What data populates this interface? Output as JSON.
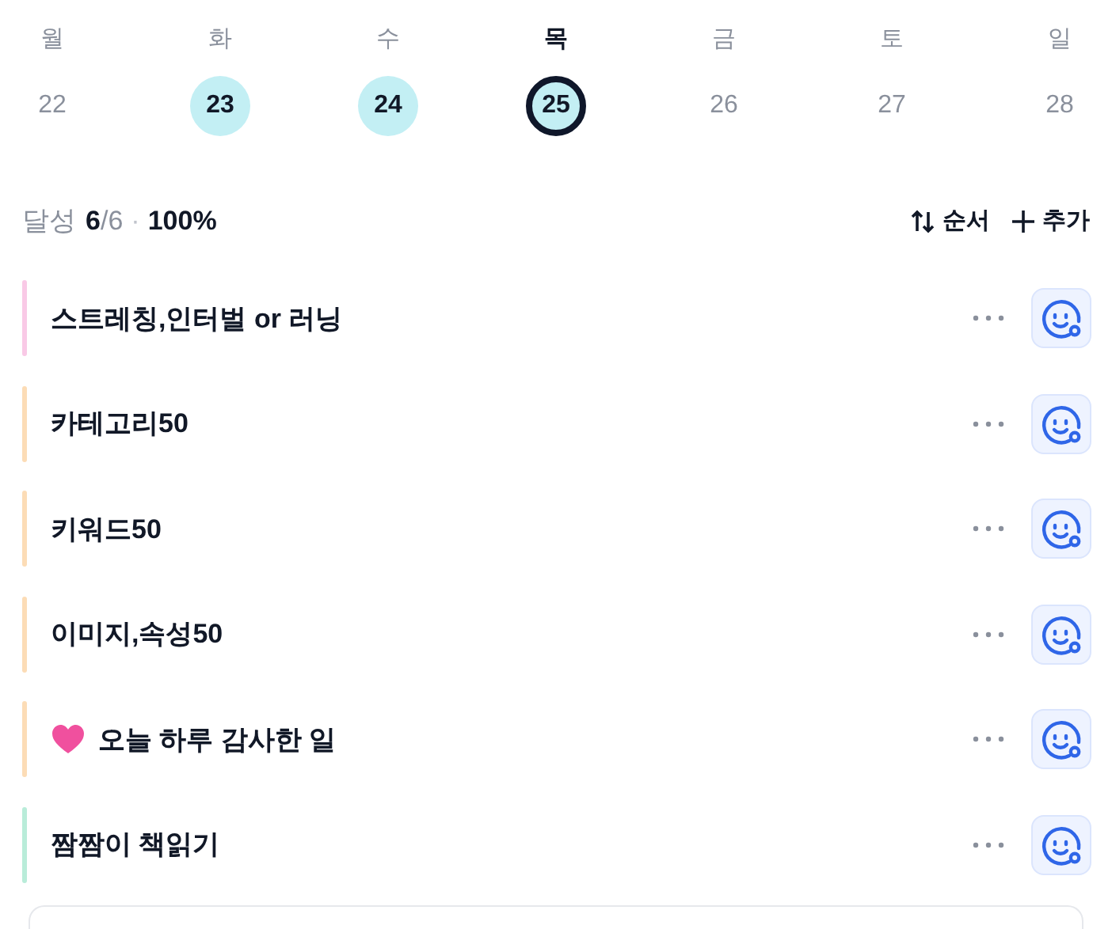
{
  "week": [
    {
      "weekday": "월",
      "date": "22",
      "done": false,
      "selected": false
    },
    {
      "weekday": "화",
      "date": "23",
      "done": true,
      "selected": false
    },
    {
      "weekday": "수",
      "date": "24",
      "done": true,
      "selected": false
    },
    {
      "weekday": "목",
      "date": "25",
      "done": true,
      "selected": true
    },
    {
      "weekday": "금",
      "date": "26",
      "done": false,
      "selected": false
    },
    {
      "weekday": "토",
      "date": "27",
      "done": false,
      "selected": false
    },
    {
      "weekday": "일",
      "date": "28",
      "done": false,
      "selected": false
    }
  ],
  "summary": {
    "label": "달성",
    "done": "6",
    "total": "/6",
    "separator": "·",
    "percent": "100%"
  },
  "actions": [
    {
      "kind": "sort",
      "label": "순서"
    },
    {
      "kind": "add",
      "label": "추가"
    }
  ],
  "habits": [
    {
      "kind": "plain",
      "title": "스트레칭,인터벌 or 러닝",
      "color": "#f9c9e6"
    },
    {
      "kind": "plain",
      "title": "카테고리50",
      "color": "#fcdcb6"
    },
    {
      "kind": "plain",
      "title": "키워드50",
      "color": "#fcdcb6"
    },
    {
      "kind": "plain",
      "title": "이미지,속성50",
      "color": "#fcdcb6"
    },
    {
      "kind": "emoji",
      "title": "오늘 하루 감사한 일",
      "color": "#fcdcb6"
    },
    {
      "kind": "plain",
      "title": "짬짬이 책읽기",
      "color": "#b9ecd9"
    }
  ]
}
